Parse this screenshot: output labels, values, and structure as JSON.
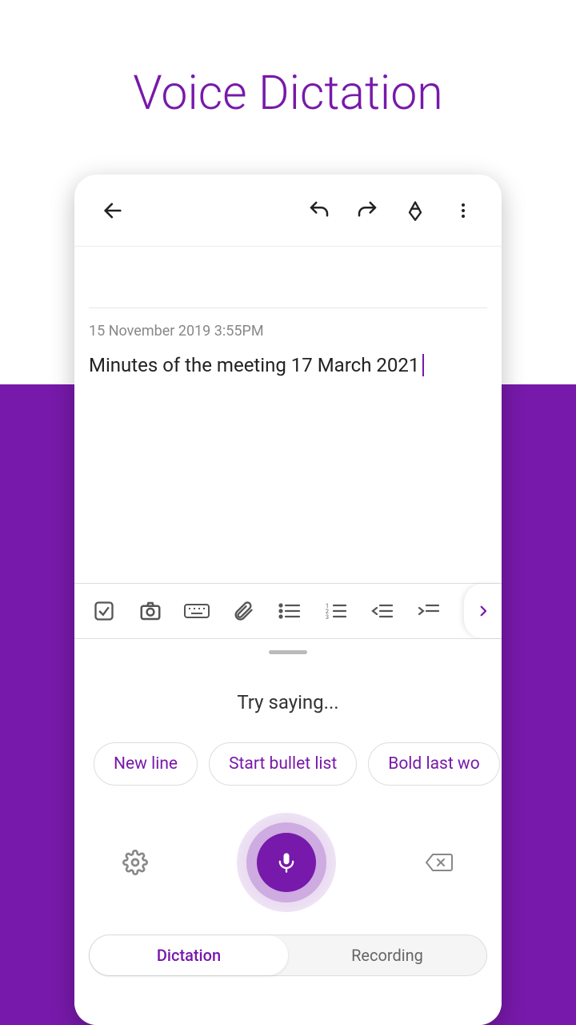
{
  "hero": {
    "title": "Voice Dictation"
  },
  "note": {
    "timestamp": "15 November 2019 3:55PM",
    "body": "Minutes of the meeting 17 March 2021"
  },
  "dictation": {
    "prompt": "Try saying...",
    "chips": [
      "New line",
      "Start bullet list",
      "Bold last wo"
    ],
    "tabs": {
      "active": "Dictation",
      "inactive": "Recording"
    }
  }
}
